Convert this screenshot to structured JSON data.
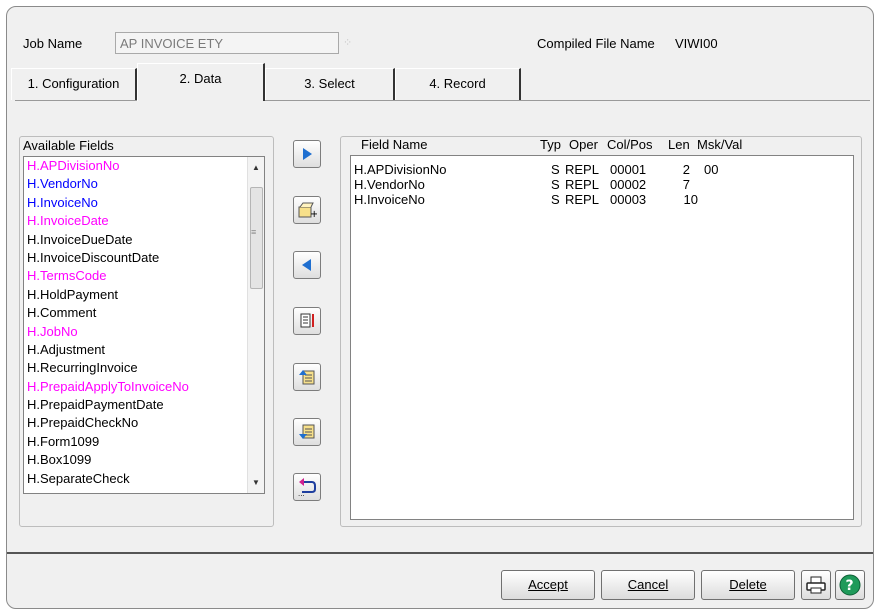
{
  "header": {
    "job_name_label": "Job Name",
    "job_name_value": "AP INVOICE ETY",
    "compiled_label": "Compiled File Name",
    "compiled_value": "VIWI00"
  },
  "tabs": [
    {
      "label": "1. Configuration",
      "active": false
    },
    {
      "label": "2. Data",
      "active": true
    },
    {
      "label": "3. Select",
      "active": false
    },
    {
      "label": "4. Record",
      "active": false
    }
  ],
  "available_fields": {
    "title": "Available Fields",
    "items": [
      {
        "text": "H.APDivisionNo",
        "color": "#ff00ff"
      },
      {
        "text": "H.VendorNo",
        "color": "#0000ff"
      },
      {
        "text": "H.InvoiceNo",
        "color": "#0000ff"
      },
      {
        "text": "H.InvoiceDate",
        "color": "#ff00ff"
      },
      {
        "text": "H.InvoiceDueDate",
        "color": "#000000"
      },
      {
        "text": "H.InvoiceDiscountDate",
        "color": "#000000"
      },
      {
        "text": "H.TermsCode",
        "color": "#ff00ff"
      },
      {
        "text": "H.HoldPayment",
        "color": "#000000"
      },
      {
        "text": "H.Comment",
        "color": "#000000"
      },
      {
        "text": "H.JobNo",
        "color": "#ff00ff"
      },
      {
        "text": "H.Adjustment",
        "color": "#000000"
      },
      {
        "text": "H.RecurringInvoice",
        "color": "#000000"
      },
      {
        "text": "H.PrepaidApplyToInvoiceNo",
        "color": "#ff00ff"
      },
      {
        "text": "H.PrepaidPaymentDate",
        "color": "#000000"
      },
      {
        "text": "H.PrepaidCheckNo",
        "color": "#000000"
      },
      {
        "text": "H.Form1099",
        "color": "#000000"
      },
      {
        "text": "H.Box1099",
        "color": "#000000"
      },
      {
        "text": "H.SeparateCheck",
        "color": "#000000"
      }
    ]
  },
  "grid": {
    "columns": [
      "Field Name",
      "Typ",
      "Oper",
      "Col/Pos",
      "Len",
      "Msk/Val"
    ],
    "rows": [
      [
        "H.APDivisionNo",
        "S",
        "REPL",
        "00001",
        "2",
        "00"
      ],
      [
        "H.VendorNo",
        "S",
        "REPL",
        "00002",
        "7",
        ""
      ],
      [
        "H.InvoiceNo",
        "S",
        "REPL",
        "00003",
        "10",
        ""
      ]
    ]
  },
  "buttons": {
    "accept": "Accept",
    "cancel": "Cancel",
    "delete": "Delete"
  }
}
